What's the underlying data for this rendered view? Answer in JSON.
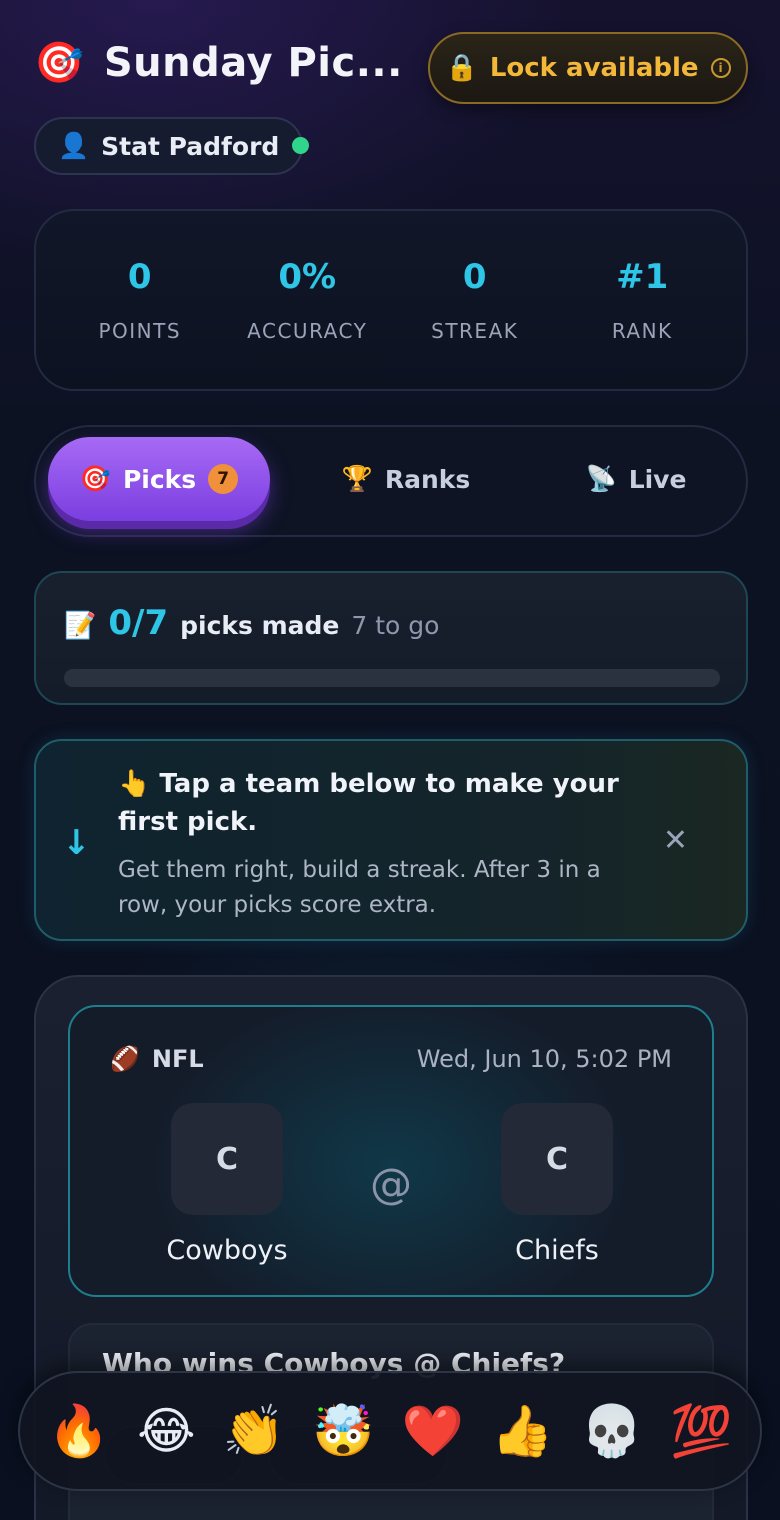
{
  "header": {
    "title_icon": "🎯",
    "title": "Sunday Pic...",
    "lock_icon": "🔒",
    "lock_label": "Lock available",
    "lock_info_icon": "i"
  },
  "user": {
    "avatar_icon": "👤",
    "name": "Stat Padford",
    "online_color": "#2ed58a"
  },
  "stats": [
    {
      "value": "0",
      "label": "POINTS"
    },
    {
      "value": "0%",
      "label": "ACCURACY"
    },
    {
      "value": "0",
      "label": "STREAK"
    },
    {
      "value": "#1",
      "label": "RANK"
    }
  ],
  "tabs": {
    "picks": {
      "icon": "🎯",
      "label": "Picks",
      "badge": "7"
    },
    "ranks": {
      "icon": "🏆",
      "label": "Ranks"
    },
    "live": {
      "icon": "📡",
      "label": "Live"
    }
  },
  "progress": {
    "icon": "📝",
    "count": "0/7",
    "label": "picks made",
    "sub": "7 to go",
    "fraction": 0
  },
  "tip": {
    "arrow_icon": "↓",
    "title": "👆 Tap a team below to make your first pick.",
    "body": "Get them right, build a streak. After 3 in a row, your picks score extra.",
    "close_icon": "✕"
  },
  "game": {
    "league_icon": "🏈",
    "league": "NFL",
    "time": "Wed, Jun 10, 5:02 PM",
    "away": {
      "initial": "C",
      "name": "Cowboys"
    },
    "at": "@",
    "home": {
      "initial": "C",
      "name": "Chiefs"
    },
    "question": "Who wins Cowboys @ Chiefs?"
  },
  "reactions": [
    "🔥",
    "😂",
    "👏",
    "🤯",
    "❤️",
    "👍",
    "💀",
    "💯"
  ],
  "colors": {
    "accent": "#2ec5e6",
    "tab_active": "#8b4ff0",
    "lock": "#f3b73a"
  }
}
